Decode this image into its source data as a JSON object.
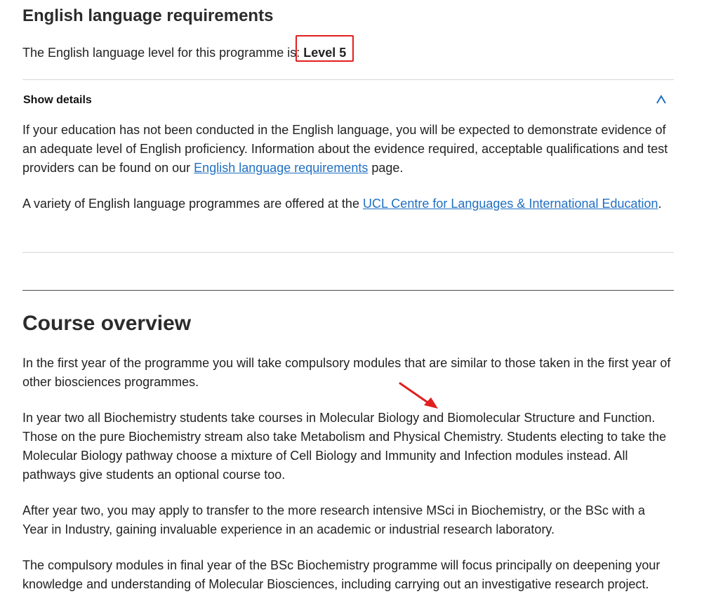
{
  "english": {
    "heading": "English language requirements",
    "level_prefix": "The English language level for this programme is: ",
    "level_value": "Level 5",
    "show_details_label": "Show details",
    "details": {
      "p1_before": "If your education has not been conducted in the English language, you will be expected to demonstrate evidence of an adequate level of English proficiency. Information about the evidence required, acceptable qualifications and test providers can be found on our ",
      "p1_link": "English language requirements",
      "p1_after": " page.",
      "p2_before": "A variety of English language programmes are offered at the ",
      "p2_link": "UCL Centre for Languages & International Education",
      "p2_after": "."
    }
  },
  "overview": {
    "heading": "Course overview",
    "paragraphs": [
      "In the first year of the programme you will take compulsory modules that are similar to those taken in the first year of other biosciences programmes.",
      "In year two all Biochemistry students take courses in Molecular Biology and Biomolecular Structure and Function. Those on the pure Biochemistry stream also take Metabolism and Physical Chemistry. Students electing to take the Molecular Biology pathway choose a mixture of Cell Biology and Immunity and Infection modules instead. All pathways give students an optional course too.",
      "After year two, you may apply to transfer to the more research intensive MSci in Biochemistry, or the BSc with a Year in Industry, gaining invaluable experience in an academic or industrial research laboratory.",
      "The compulsory modules in final year of the BSc Biochemistry programme will focus principally on deepening your knowledge and understanding of Molecular Biosciences, including carrying out an investigative research project."
    ]
  },
  "colors": {
    "link": "#1f6fc2",
    "annotation_red": "#e0201e",
    "chevron": "#1f6fc2"
  },
  "icons": {
    "chevron": "chevron-up-icon",
    "arrow": "red-arrow-annotation-icon"
  }
}
